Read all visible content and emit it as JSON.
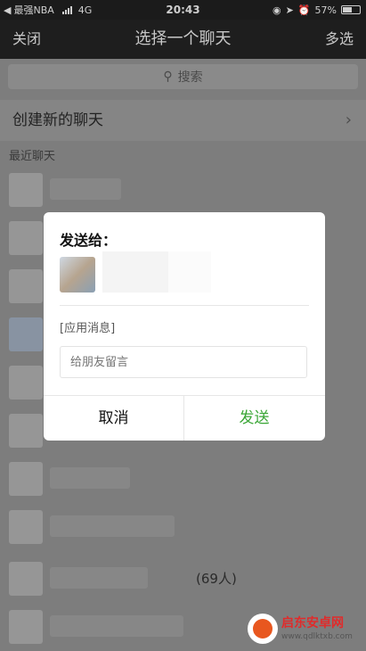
{
  "status_bar": {
    "carrier": "最强NBA",
    "network": "4G",
    "time": "20:43",
    "battery": "57%",
    "battery_level": 0.57
  },
  "nav": {
    "close_label": "关闭",
    "title": "选择一个聊天",
    "multi_select_label": "多选"
  },
  "search": {
    "placeholder": "搜索"
  },
  "new_chat": {
    "label": "创建新的聊天"
  },
  "recent_section": {
    "label": "最近聊天"
  },
  "recent_rows": [
    {
      "text": ""
    },
    {
      "text": ""
    },
    {
      "text": ""
    },
    {
      "text": ""
    },
    {
      "text": ""
    },
    {
      "text": ""
    },
    {
      "text": ""
    },
    {
      "text": ""
    },
    {
      "text": "(69人)"
    },
    {
      "text": ""
    }
  ],
  "dialog": {
    "heading": "发送给：",
    "app_message": "[应用消息]",
    "input_placeholder": "给朋友留言",
    "cancel_label": "取消",
    "send_label": "发送",
    "send_color": "#3aa636"
  },
  "watermark": {
    "title": "启东安卓网",
    "url": "www.qdlktxb.com"
  }
}
